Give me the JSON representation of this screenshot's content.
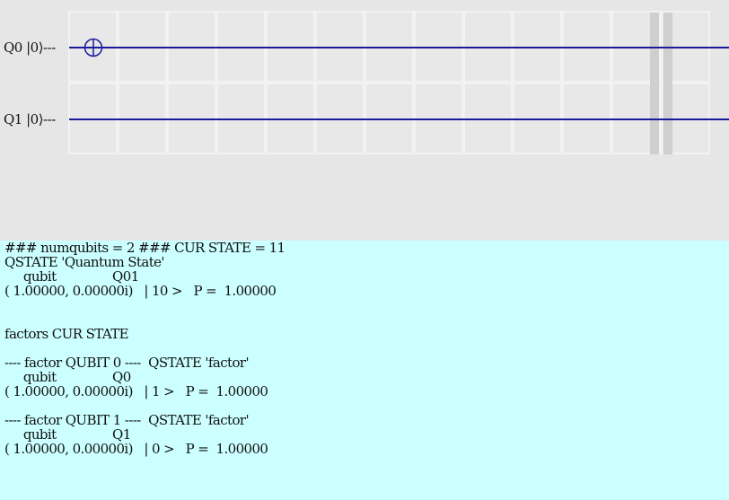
{
  "circuit": {
    "qubits": [
      {
        "label": "Q0 |0⟩---",
        "gate": "cnot-target"
      },
      {
        "label": "Q1 |0⟩---",
        "gate": null
      }
    ],
    "columns": 13,
    "wire_color": "#1a1a9c"
  },
  "console": {
    "lines": [
      "### numqubits = 2 ### CUR STATE = 11",
      "QSTATE 'Quantum State'",
      "     qubit               Q01",
      "( 1.00000, 0.00000i)   | 10 >   P =  1.00000",
      "",
      "",
      "factors CUR STATE",
      "",
      "---- factor QUBIT 0 ----  QSTATE 'factor'",
      "     qubit               Q0",
      "( 1.00000, 0.00000i)   | 1 >   P =  1.00000",
      "",
      "---- factor QUBIT 1 ----  QSTATE 'factor'",
      "     qubit               Q1",
      "( 1.00000, 0.00000i)   | 0 >   P =  1.00000"
    ]
  }
}
